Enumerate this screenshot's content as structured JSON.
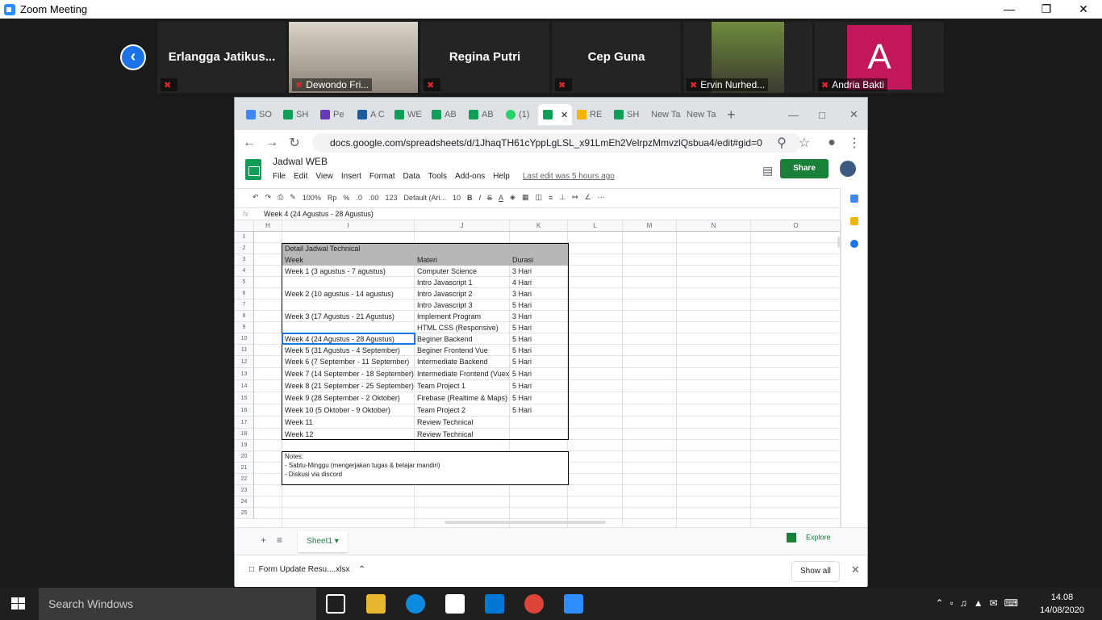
{
  "zoom": {
    "title": "Zoom Meeting",
    "participants": [
      {
        "name": "Erlangga  Jatikus...",
        "label": ""
      },
      {
        "name": "",
        "label": "Dewondo Fri..."
      },
      {
        "name": "Regina Putri",
        "label": ""
      },
      {
        "name": "Cep Guna",
        "label": ""
      },
      {
        "name": "",
        "label": "Ervin Nurhed..."
      },
      {
        "name": "A",
        "label": "Andria Bakti"
      }
    ]
  },
  "browser": {
    "tabs": [
      "SO",
      "SH",
      "Pe",
      "A C",
      "WE",
      "AB",
      "AB",
      "(1)",
      "",
      "RE",
      "SH",
      "New Ta",
      "New Ta"
    ],
    "url": "docs.google.com/spreadsheets/d/1JhaqTH61cYppLgLSL_x91LmEh2VelrpzMmvzlQsbua4/edit#gid=0"
  },
  "sheets": {
    "title": "Jadwal WEB",
    "menu": [
      "File",
      "Edit",
      "View",
      "Insert",
      "Format",
      "Data",
      "Tools",
      "Add-ons",
      "Help"
    ],
    "last_edit": "Last edit was 5 hours ago",
    "share": "Share",
    "toolbar": {
      "zoom": "100%",
      "currency": "Rp",
      "percent": "%",
      "dec1": ".0",
      "dec2": ".00",
      "fmt": "123",
      "font": "Default (Ari...",
      "size": "10"
    },
    "formula": "Week 4 (24 Agustus - 28 Agustus)",
    "fx": "fx",
    "columns": [
      "H",
      "I",
      "J",
      "K",
      "L",
      "M",
      "N",
      "O"
    ],
    "rows": [
      "1",
      "2",
      "3",
      "4",
      "5",
      "6",
      "7",
      "8",
      "9",
      "10",
      "11",
      "12",
      "13",
      "14",
      "15",
      "16",
      "17",
      "18",
      "19",
      "20",
      "21",
      "22",
      "23",
      "24",
      "25"
    ],
    "table_title": "Detail Jadwal Technical",
    "headers": [
      "Week",
      "Materi",
      "Durasi"
    ],
    "data": [
      [
        "Week 1 (3 agustus - 7 agustus)",
        "Computer Science",
        "3 Hari"
      ],
      [
        "",
        "Intro Javascript 1",
        "4 Hari"
      ],
      [
        "Week 2 (10 agustus - 14 agustus)",
        "Intro Javascript 2",
        "3 Hari"
      ],
      [
        "",
        "Intro Javascript 3",
        "5 Hari"
      ],
      [
        "Week 3 (17 Agustus - 21 Agustus)",
        "Implement Program",
        "3 Hari"
      ],
      [
        "",
        "HTML CSS (Responsive)",
        "5 Hari"
      ],
      [
        "Week 4 (24 Agustus - 28 Agustus)",
        "Beginer Backend",
        "5 Hari"
      ],
      [
        "Week 5 (31 Agustus - 4 September)",
        "Beginer Frontend Vue",
        "5 Hari"
      ],
      [
        "Week 6 (7 September - 11 September)",
        "Intermediate Backend",
        "5 Hari"
      ],
      [
        "Week 7 (14 September - 18 September)",
        "Intermediate Frontend (Vuex)",
        "5 Hari"
      ],
      [
        "Week 8 (21 September -  25 September)",
        "Team Project 1",
        "5 Hari"
      ],
      [
        "Week 9 (28 September - 2 Oktober)",
        "Firebase (Realtime & Maps)",
        "5 Hari"
      ],
      [
        "Week 10 (5 Oktober - 9 Oktober)",
        "Team Project 2",
        "5 Hari"
      ],
      [
        "Week 11",
        "Review Technical",
        ""
      ],
      [
        "Week 12",
        "Review Technical",
        ""
      ]
    ],
    "notes": [
      "Notes:",
      "- Sabtu-Minggu (mengerjakan tugas & belajar mandiri)",
      "- Diskusi via discord"
    ],
    "sheet_tab": "Sheet1",
    "explore": "Explore"
  },
  "downloads": {
    "file": "Form Update Resu....xlsx",
    "show_all": "Show all"
  },
  "taskbar": {
    "search": "Search Windows",
    "time": "14.08",
    "date": "14/08/2020"
  }
}
